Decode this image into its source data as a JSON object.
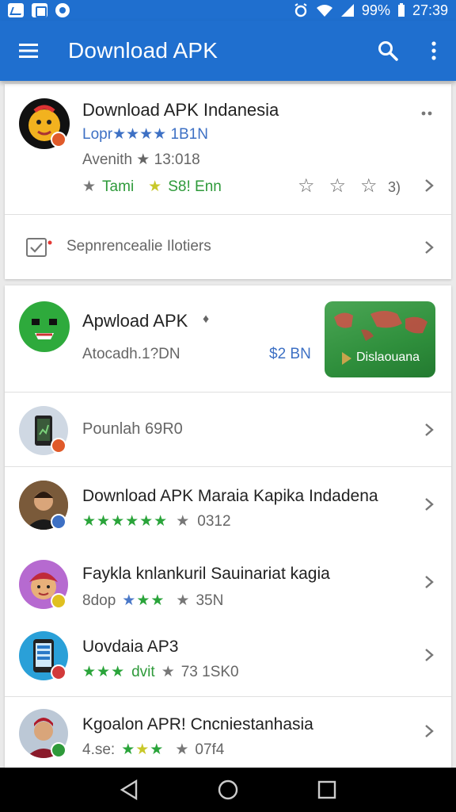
{
  "status_bar": {
    "battery": "99%",
    "time": "27:39"
  },
  "app_bar": {
    "title": "Download APK"
  },
  "featured": {
    "title": "Download APK Indanesia",
    "rating_line": "Lopr★★★★ 1B1N",
    "meta_line": "Avenith ★ 13:018",
    "tag_left": "Tami",
    "tag_right": "S8! Enn",
    "star_count": "3)",
    "row_label": "Sepnrencealie Ilotiers"
  },
  "promo": {
    "title": "Apwload APK",
    "title_suffix": "♦",
    "subtitle": "Atocadh.1?DN",
    "price": "$2 BN",
    "banner_label": "Dislaouana"
  },
  "apps": [
    {
      "title": "Pounlah 69R0"
    },
    {
      "title": "Download APK Maraia Kapika Indadena",
      "count": "0312"
    },
    {
      "title": "Faykla knlankuril Sauinariat kagia",
      "prefix": "8dop",
      "count": "35N"
    },
    {
      "title": "Uovdaia AP3",
      "prefix": "dvit",
      "count": "73  1SK0"
    },
    {
      "title": "Kgoalon APR! Cncniestanhasia",
      "prefix": "4.se:",
      "count": "07f4"
    }
  ],
  "colors": {
    "primary": "#1f6fcf",
    "green": "#2e9a3a",
    "blue_text": "#3d70c4"
  }
}
